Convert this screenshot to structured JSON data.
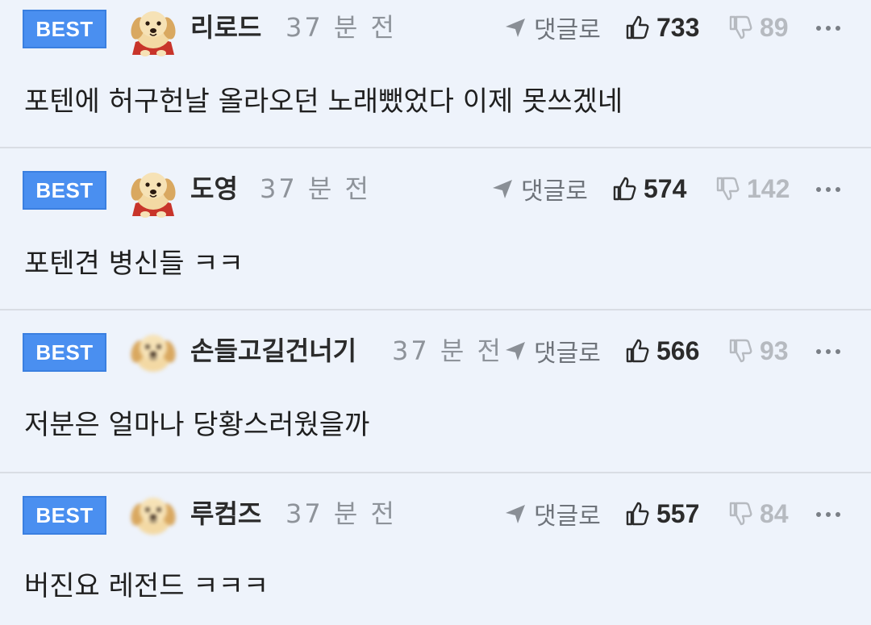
{
  "icons": {
    "reply": "send-arrow-icon",
    "like": "thumbs-up-icon",
    "dislike": "thumbs-down-icon",
    "more": "more-dots-icon",
    "avatar_dog": "dog-avatar-icon"
  },
  "colors": {
    "background": "#eef3fb",
    "badge": "#4a8ff0",
    "divider": "#d9dde4"
  },
  "reply_label": "댓글로",
  "comments": [
    {
      "badge": "BEST",
      "author": "리로드",
      "time": "37 분 전",
      "likes": "733",
      "dislikes": "89",
      "text": "포텐에 허구헌날 올라오던 노래뺐었다 이제 못쓰겠네"
    },
    {
      "badge": "BEST",
      "author": "도영",
      "time": "37 분 전",
      "likes": "574",
      "dislikes": "142",
      "text": "포텐견 병신들 ㅋㅋ"
    },
    {
      "badge": "BEST",
      "author": "손들고길건너기",
      "time": "37 분 전",
      "likes": "566",
      "dislikes": "93",
      "text": "저분은 얼마나 당황스러웠을까"
    },
    {
      "badge": "BEST",
      "author": "루컴즈",
      "time": "37 분 전",
      "likes": "557",
      "dislikes": "84",
      "text": "버진요 레전드 ㅋㅋㅋ"
    }
  ]
}
